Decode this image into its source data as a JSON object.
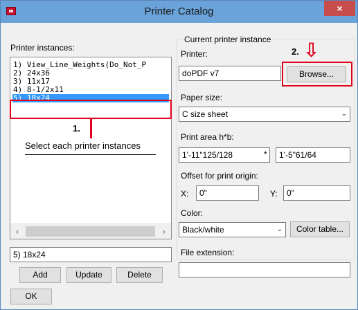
{
  "window": {
    "title": "Printer Catalog",
    "close_glyph": "×"
  },
  "left": {
    "instances_label": "Printer instances:",
    "items": [
      "1) View_Line_Weights(Do_Not_P",
      "2) 24x36",
      "3) 11x17",
      "4) 8-1/2x11",
      "5) 18x24"
    ],
    "selected_index": 4,
    "name_value": "5) 18x24",
    "add_label": "Add",
    "update_label": "Update",
    "delete_label": "Delete",
    "ok_label": "OK"
  },
  "right": {
    "group_title": "Current printer instance",
    "printer_label": "Printer:",
    "printer_value": "doPDF v7",
    "browse_label": "Browse...",
    "paper_size_label": "Paper size:",
    "paper_size_value": "C size sheet",
    "print_area_label": "Print area h*b:",
    "print_area_h": "1'-11\"125/128",
    "print_area_sep": "*",
    "print_area_b": "1'-5\"61/64",
    "offset_label": "Offset for print origin:",
    "x_label": "X:",
    "x_value": "0\"",
    "y_label": "Y:",
    "y_value": "0\"",
    "color_label": "Color:",
    "color_value": "Black/white",
    "color_table_label": "Color table...",
    "file_ext_label": "File extension:",
    "file_ext_value": ""
  },
  "annotations": {
    "step1": "1.",
    "step1_text": "Select each printer instances",
    "step2": "2.",
    "arrow_glyph": "⇩",
    "highlight_color": "#e0001b"
  },
  "icons": {
    "scroll_left": "‹",
    "scroll_right": "›",
    "chevron": "⌄"
  }
}
